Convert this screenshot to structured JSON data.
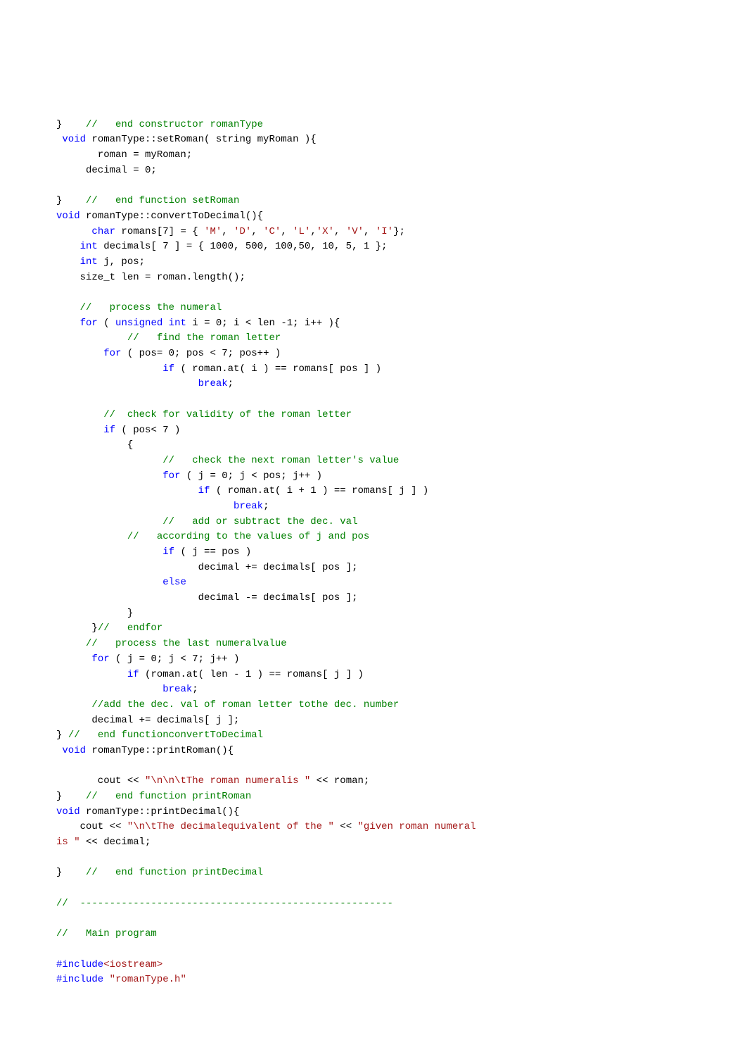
{
  "lines": [
    [
      [
        "pl",
        "}    "
      ],
      [
        "cm",
        "//   end constructor romanType"
      ]
    ],
    [
      [
        "pl",
        " "
      ],
      [
        "kw",
        "void"
      ],
      [
        "pl",
        " romanType::setRoman( string myRoman ){"
      ]
    ],
    [
      [
        "pl",
        "       roman = myRoman;"
      ]
    ],
    [
      [
        "pl",
        "     decimal = 0;"
      ]
    ],
    [
      [
        "pl",
        ""
      ]
    ],
    [
      [
        "pl",
        "}    "
      ],
      [
        "cm",
        "//   end function setRoman"
      ]
    ],
    [
      [
        "kw",
        "void"
      ],
      [
        "pl",
        " romanType::convertToDecimal(){"
      ]
    ],
    [
      [
        "pl",
        "      "
      ],
      [
        "kw",
        "char"
      ],
      [
        "pl",
        " romans[7] = { "
      ],
      [
        "str",
        "'M'"
      ],
      [
        "pl",
        ", "
      ],
      [
        "str",
        "'D'"
      ],
      [
        "pl",
        ", "
      ],
      [
        "str",
        "'C'"
      ],
      [
        "pl",
        ", "
      ],
      [
        "str",
        "'L'"
      ],
      [
        "pl",
        ","
      ],
      [
        "str",
        "'X'"
      ],
      [
        "pl",
        ", "
      ],
      [
        "str",
        "'V'"
      ],
      [
        "pl",
        ", "
      ],
      [
        "str",
        "'I'"
      ],
      [
        "pl",
        "};"
      ]
    ],
    [
      [
        "pl",
        "    "
      ],
      [
        "kw",
        "int"
      ],
      [
        "pl",
        " decimals[ 7 ] = { 1000, 500, 100,50, 10, 5, 1 };"
      ]
    ],
    [
      [
        "pl",
        "    "
      ],
      [
        "kw",
        "int"
      ],
      [
        "pl",
        " j, pos;"
      ]
    ],
    [
      [
        "pl",
        "    size_t len = roman.length();"
      ]
    ],
    [
      [
        "pl",
        ""
      ]
    ],
    [
      [
        "pl",
        "    "
      ],
      [
        "cm",
        "//   process the numeral"
      ]
    ],
    [
      [
        "pl",
        "    "
      ],
      [
        "kw",
        "for"
      ],
      [
        "pl",
        " ( "
      ],
      [
        "kw",
        "unsigned"
      ],
      [
        "pl",
        " "
      ],
      [
        "kw",
        "int"
      ],
      [
        "pl",
        " i = 0; i < len -1; i++ ){"
      ]
    ],
    [
      [
        "pl",
        "            "
      ],
      [
        "cm",
        "//   find the roman letter"
      ]
    ],
    [
      [
        "pl",
        "        "
      ],
      [
        "kw",
        "for"
      ],
      [
        "pl",
        " ( pos= 0; pos < 7; pos++ )"
      ]
    ],
    [
      [
        "pl",
        "                  "
      ],
      [
        "kw",
        "if"
      ],
      [
        "pl",
        " ( roman.at( i ) == romans[ pos ] )"
      ]
    ],
    [
      [
        "pl",
        "                        "
      ],
      [
        "kw",
        "break"
      ],
      [
        "pl",
        ";"
      ]
    ],
    [
      [
        "pl",
        ""
      ]
    ],
    [
      [
        "pl",
        "        "
      ],
      [
        "cm",
        "//  check for validity of the roman letter"
      ]
    ],
    [
      [
        "pl",
        "        "
      ],
      [
        "kw",
        "if"
      ],
      [
        "pl",
        " ( pos< 7 )"
      ]
    ],
    [
      [
        "pl",
        "            {"
      ]
    ],
    [
      [
        "pl",
        "                  "
      ],
      [
        "cm",
        "//   check the next roman letter's value"
      ]
    ],
    [
      [
        "pl",
        "                  "
      ],
      [
        "kw",
        "for"
      ],
      [
        "pl",
        " ( j = 0; j < pos; j++ )"
      ]
    ],
    [
      [
        "pl",
        "                        "
      ],
      [
        "kw",
        "if"
      ],
      [
        "pl",
        " ( roman.at( i + 1 ) == romans[ j ] )"
      ]
    ],
    [
      [
        "pl",
        "                              "
      ],
      [
        "kw",
        "break"
      ],
      [
        "pl",
        ";"
      ]
    ],
    [
      [
        "pl",
        "                  "
      ],
      [
        "cm",
        "//   add or subtract the dec. val"
      ]
    ],
    [
      [
        "pl",
        "            "
      ],
      [
        "cm",
        "//   according to the values of j and pos"
      ]
    ],
    [
      [
        "pl",
        "                  "
      ],
      [
        "kw",
        "if"
      ],
      [
        "pl",
        " ( j == pos )"
      ]
    ],
    [
      [
        "pl",
        "                        decimal += decimals[ pos ];"
      ]
    ],
    [
      [
        "pl",
        "                  "
      ],
      [
        "kw",
        "else"
      ]
    ],
    [
      [
        "pl",
        "                        decimal -= decimals[ pos ];"
      ]
    ],
    [
      [
        "pl",
        "            }"
      ]
    ],
    [
      [
        "pl",
        "      }"
      ],
      [
        "cm",
        "//   endfor"
      ]
    ],
    [
      [
        "pl",
        "     "
      ],
      [
        "cm",
        "//   process the last numeralvalue"
      ]
    ],
    [
      [
        "pl",
        "      "
      ],
      [
        "kw",
        "for"
      ],
      [
        "pl",
        " ( j = 0; j < 7; j++ )"
      ]
    ],
    [
      [
        "pl",
        "            "
      ],
      [
        "kw",
        "if"
      ],
      [
        "pl",
        " (roman.at( len - 1 ) == romans[ j ] )"
      ]
    ],
    [
      [
        "pl",
        "                  "
      ],
      [
        "kw",
        "break"
      ],
      [
        "pl",
        ";"
      ]
    ],
    [
      [
        "pl",
        "      "
      ],
      [
        "cm",
        "//add the dec. val of roman letter tothe dec. number"
      ]
    ],
    [
      [
        "pl",
        "      decimal += decimals[ j ];"
      ]
    ],
    [
      [
        "pl",
        "} "
      ],
      [
        "cm",
        "//   end functionconvertToDecimal"
      ]
    ],
    [
      [
        "pl",
        " "
      ],
      [
        "kw",
        "void"
      ],
      [
        "pl",
        " romanType::printRoman(){"
      ]
    ],
    [
      [
        "pl",
        ""
      ]
    ],
    [
      [
        "pl",
        "       cout << "
      ],
      [
        "str",
        "\"\\n\\n\\tThe roman numeralis \""
      ],
      [
        "pl",
        " << roman;"
      ]
    ],
    [
      [
        "pl",
        "}    "
      ],
      [
        "cm",
        "//   end function printRoman"
      ]
    ],
    [
      [
        "kw",
        "void"
      ],
      [
        "pl",
        " romanType::printDecimal(){"
      ]
    ],
    [
      [
        "pl",
        "    cout << "
      ],
      [
        "str",
        "\"\\n\\tThe decimalequivalent of the \""
      ],
      [
        "pl",
        " << "
      ],
      [
        "str",
        "\"given roman numeral "
      ]
    ],
    [
      [
        "str",
        "is \""
      ],
      [
        "pl",
        " << decimal;"
      ]
    ],
    [
      [
        "pl",
        ""
      ]
    ],
    [
      [
        "pl",
        "}    "
      ],
      [
        "cm",
        "//   end function printDecimal"
      ]
    ],
    [
      [
        "pl",
        ""
      ]
    ],
    [
      [
        "cm",
        "//  -----------------------------------------------------"
      ]
    ],
    [
      [
        "pl",
        ""
      ]
    ],
    [
      [
        "cm",
        "//   Main program"
      ]
    ],
    [
      [
        "pl",
        ""
      ]
    ],
    [
      [
        "kw",
        "#include"
      ],
      [
        "str",
        "<iostream>"
      ]
    ],
    [
      [
        "kw",
        "#include"
      ],
      [
        "pl",
        " "
      ],
      [
        "str",
        "\"romanType.h\""
      ]
    ]
  ]
}
